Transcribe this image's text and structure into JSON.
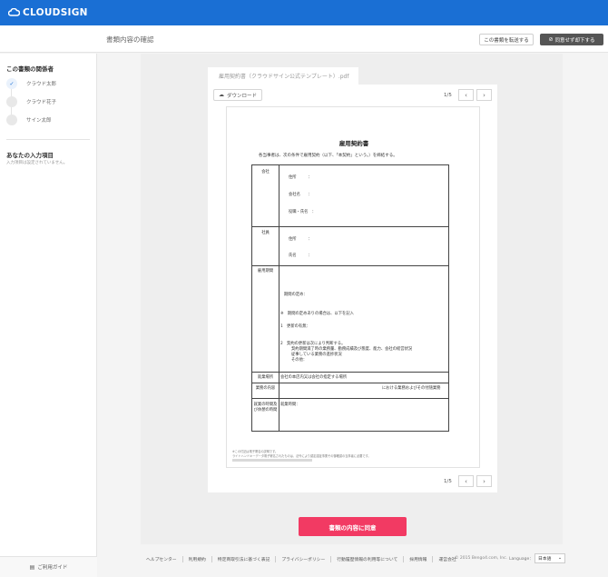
{
  "header": {
    "brand": "CLOUDSIGN",
    "page_title": "書類内容の確認",
    "forward_label": "この書類を転送する",
    "decline_label": "同意せず却下する",
    "colors": {
      "brand": "#1a6fd4",
      "agree": "#f23a63"
    }
  },
  "sidebar": {
    "parties_heading": "この書類の関係者",
    "parties": [
      {
        "name": "クラウド太郎",
        "status": "check-icon"
      },
      {
        "name": "クラウド花子",
        "status": ""
      },
      {
        "name": "サイン太郎",
        "status": ""
      }
    ],
    "inputs_heading": "あなたの入力項目",
    "inputs_note": "入力項目は設定されていません。",
    "guide_label": "ご利用ガイド"
  },
  "viewer": {
    "doc_tab": "雇用契約書（クラウドサイン公式テンプレート）.pdf",
    "download_label": "ダウンロード",
    "page_indicator": "1/5",
    "prev_icon": "‹",
    "next_icon": "›"
  },
  "document": {
    "title": "雇用契約書",
    "intro": "各当事者は、次の条件で雇用契約（以下、「本契約」という。）を締結する。",
    "rows": {
      "company_label": "会社",
      "company_address": "住所　　　：",
      "company_name": "会社名　　：",
      "company_rep": "役職・氏名　：",
      "employee_label": "社員",
      "employee_address": "住所　　　：",
      "employee_name": "氏名　　　：",
      "period_label": "雇用期間",
      "period_start": "期間の定め：",
      "period_note": "※　期間の定めありの場合は、以下を記入",
      "renewal_1": "1　更新の有無：",
      "renewal_2": "2　契約の更新は次により判断する。",
      "renewal_2a": "契約期間満了時の業務量、勤務成績及び態度、能力、会社の経営状況",
      "renewal_2b": "従事している業務の進捗状況",
      "renewal_2c": "その他：",
      "workplace_label": "就業場所",
      "workplace_value": "会社の本店内又は会社の指定する場所",
      "duties_label": "業務の内容",
      "duties_value": "における業務およびその付随業務",
      "hours_label_1": "就業の時間及",
      "hours_label_2": "び休憩の時間",
      "hours_value": "就業時間："
    },
    "fine_1": "※この付記は電子署名の説明です。",
    "fine_2": "ライトハンドキーデータ電子署名されたものは、法令により認定認証事業その御確認の当事者に必要です。"
  },
  "agree_label": "書類の内容に同意",
  "footer": {
    "links": [
      "ヘルプセンター",
      "利用規約",
      "特定商取引法に基づく表記",
      "プライバシーポリシー",
      "行動履歴情報の利用等について",
      "採用情報",
      "運営会社"
    ],
    "copyright": "© 2015 Bengo4.com, Inc.",
    "language_label": "Language：",
    "language_value": "日本語"
  }
}
